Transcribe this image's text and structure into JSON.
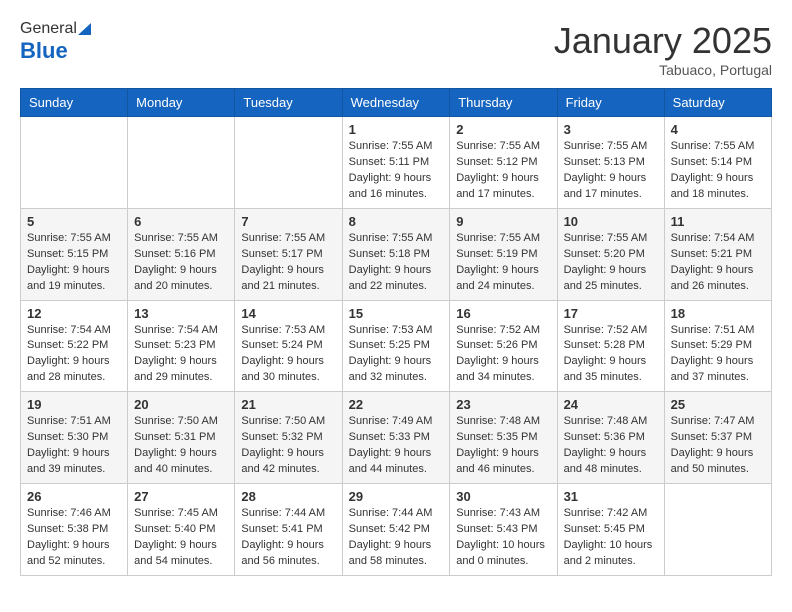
{
  "logo": {
    "general": "General",
    "blue": "Blue"
  },
  "header": {
    "month": "January 2025",
    "location": "Tabuaco, Portugal"
  },
  "days_of_week": [
    "Sunday",
    "Monday",
    "Tuesday",
    "Wednesday",
    "Thursday",
    "Friday",
    "Saturday"
  ],
  "weeks": [
    [
      {
        "day": "",
        "info": ""
      },
      {
        "day": "",
        "info": ""
      },
      {
        "day": "",
        "info": ""
      },
      {
        "day": "1",
        "info": "Sunrise: 7:55 AM\nSunset: 5:11 PM\nDaylight: 9 hours\nand 16 minutes."
      },
      {
        "day": "2",
        "info": "Sunrise: 7:55 AM\nSunset: 5:12 PM\nDaylight: 9 hours\nand 17 minutes."
      },
      {
        "day": "3",
        "info": "Sunrise: 7:55 AM\nSunset: 5:13 PM\nDaylight: 9 hours\nand 17 minutes."
      },
      {
        "day": "4",
        "info": "Sunrise: 7:55 AM\nSunset: 5:14 PM\nDaylight: 9 hours\nand 18 minutes."
      }
    ],
    [
      {
        "day": "5",
        "info": "Sunrise: 7:55 AM\nSunset: 5:15 PM\nDaylight: 9 hours\nand 19 minutes."
      },
      {
        "day": "6",
        "info": "Sunrise: 7:55 AM\nSunset: 5:16 PM\nDaylight: 9 hours\nand 20 minutes."
      },
      {
        "day": "7",
        "info": "Sunrise: 7:55 AM\nSunset: 5:17 PM\nDaylight: 9 hours\nand 21 minutes."
      },
      {
        "day": "8",
        "info": "Sunrise: 7:55 AM\nSunset: 5:18 PM\nDaylight: 9 hours\nand 22 minutes."
      },
      {
        "day": "9",
        "info": "Sunrise: 7:55 AM\nSunset: 5:19 PM\nDaylight: 9 hours\nand 24 minutes."
      },
      {
        "day": "10",
        "info": "Sunrise: 7:55 AM\nSunset: 5:20 PM\nDaylight: 9 hours\nand 25 minutes."
      },
      {
        "day": "11",
        "info": "Sunrise: 7:54 AM\nSunset: 5:21 PM\nDaylight: 9 hours\nand 26 minutes."
      }
    ],
    [
      {
        "day": "12",
        "info": "Sunrise: 7:54 AM\nSunset: 5:22 PM\nDaylight: 9 hours\nand 28 minutes."
      },
      {
        "day": "13",
        "info": "Sunrise: 7:54 AM\nSunset: 5:23 PM\nDaylight: 9 hours\nand 29 minutes."
      },
      {
        "day": "14",
        "info": "Sunrise: 7:53 AM\nSunset: 5:24 PM\nDaylight: 9 hours\nand 30 minutes."
      },
      {
        "day": "15",
        "info": "Sunrise: 7:53 AM\nSunset: 5:25 PM\nDaylight: 9 hours\nand 32 minutes."
      },
      {
        "day": "16",
        "info": "Sunrise: 7:52 AM\nSunset: 5:26 PM\nDaylight: 9 hours\nand 34 minutes."
      },
      {
        "day": "17",
        "info": "Sunrise: 7:52 AM\nSunset: 5:28 PM\nDaylight: 9 hours\nand 35 minutes."
      },
      {
        "day": "18",
        "info": "Sunrise: 7:51 AM\nSunset: 5:29 PM\nDaylight: 9 hours\nand 37 minutes."
      }
    ],
    [
      {
        "day": "19",
        "info": "Sunrise: 7:51 AM\nSunset: 5:30 PM\nDaylight: 9 hours\nand 39 minutes."
      },
      {
        "day": "20",
        "info": "Sunrise: 7:50 AM\nSunset: 5:31 PM\nDaylight: 9 hours\nand 40 minutes."
      },
      {
        "day": "21",
        "info": "Sunrise: 7:50 AM\nSunset: 5:32 PM\nDaylight: 9 hours\nand 42 minutes."
      },
      {
        "day": "22",
        "info": "Sunrise: 7:49 AM\nSunset: 5:33 PM\nDaylight: 9 hours\nand 44 minutes."
      },
      {
        "day": "23",
        "info": "Sunrise: 7:48 AM\nSunset: 5:35 PM\nDaylight: 9 hours\nand 46 minutes."
      },
      {
        "day": "24",
        "info": "Sunrise: 7:48 AM\nSunset: 5:36 PM\nDaylight: 9 hours\nand 48 minutes."
      },
      {
        "day": "25",
        "info": "Sunrise: 7:47 AM\nSunset: 5:37 PM\nDaylight: 9 hours\nand 50 minutes."
      }
    ],
    [
      {
        "day": "26",
        "info": "Sunrise: 7:46 AM\nSunset: 5:38 PM\nDaylight: 9 hours\nand 52 minutes."
      },
      {
        "day": "27",
        "info": "Sunrise: 7:45 AM\nSunset: 5:40 PM\nDaylight: 9 hours\nand 54 minutes."
      },
      {
        "day": "28",
        "info": "Sunrise: 7:44 AM\nSunset: 5:41 PM\nDaylight: 9 hours\nand 56 minutes."
      },
      {
        "day": "29",
        "info": "Sunrise: 7:44 AM\nSunset: 5:42 PM\nDaylight: 9 hours\nand 58 minutes."
      },
      {
        "day": "30",
        "info": "Sunrise: 7:43 AM\nSunset: 5:43 PM\nDaylight: 10 hours\nand 0 minutes."
      },
      {
        "day": "31",
        "info": "Sunrise: 7:42 AM\nSunset: 5:45 PM\nDaylight: 10 hours\nand 2 minutes."
      },
      {
        "day": "",
        "info": ""
      }
    ]
  ]
}
